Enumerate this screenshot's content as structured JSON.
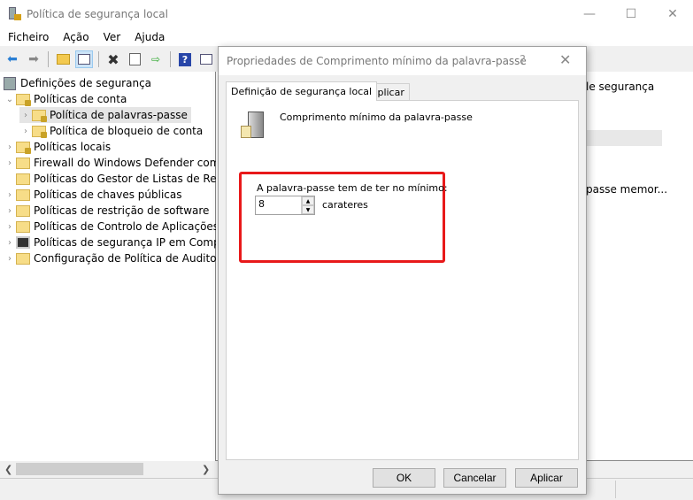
{
  "window": {
    "title": "Política de segurança local",
    "controls": {
      "minimize": "—",
      "maximize": "☐",
      "close": "✕"
    }
  },
  "menu": [
    "Ficheiro",
    "Ação",
    "Ver",
    "Ajuda"
  ],
  "toolbar": {
    "icons": [
      "back-icon",
      "forward-icon",
      "up-folder-icon",
      "show-hide-tree-icon",
      "delete-icon",
      "properties-icon",
      "export-icon",
      "help-icon",
      "show-action-pane-icon"
    ]
  },
  "tree": {
    "root": "Definições de segurança",
    "items": [
      {
        "label": "Políticas de conta",
        "level": 1,
        "expanded": true
      },
      {
        "label": "Política de palavras-passe",
        "level": 2,
        "selected": true
      },
      {
        "label": "Política de bloqueio de conta",
        "level": 2
      },
      {
        "label": "Políticas locais",
        "level": 1
      },
      {
        "label": "Firewall do Windows Defender com S",
        "level": 1
      },
      {
        "label": "Políticas do Gestor de Listas de Redes",
        "level": 1,
        "nochev": true
      },
      {
        "label": "Políticas de chaves públicas",
        "level": 1
      },
      {
        "label": "Políticas de restrição de software",
        "level": 1
      },
      {
        "label": "Políticas de Controlo de Aplicações",
        "level": 1
      },
      {
        "label": "Políticas de segurança IP em Comput",
        "level": 1
      },
      {
        "label": "Configuração de Política de Auditoria",
        "level": 1
      }
    ]
  },
  "right_pane": {
    "header_fragment": "le segurança",
    "row_fragment": "passe memor..."
  },
  "dialog": {
    "title": "Propriedades de Comprimento mínimo da palavra-passe",
    "help": "?",
    "close": "✕",
    "tabs": [
      "Definição de segurança local",
      "Explicar"
    ],
    "policy_name": "Comprimento mínimo da palavra-passe",
    "label": "A palavra-passe tem de ter no mínimo:",
    "value": "8",
    "unit": "carateres",
    "highlight_color": "#e8191a",
    "buttons": {
      "ok": "OK",
      "cancel": "Cancelar",
      "apply": "Aplicar"
    }
  }
}
